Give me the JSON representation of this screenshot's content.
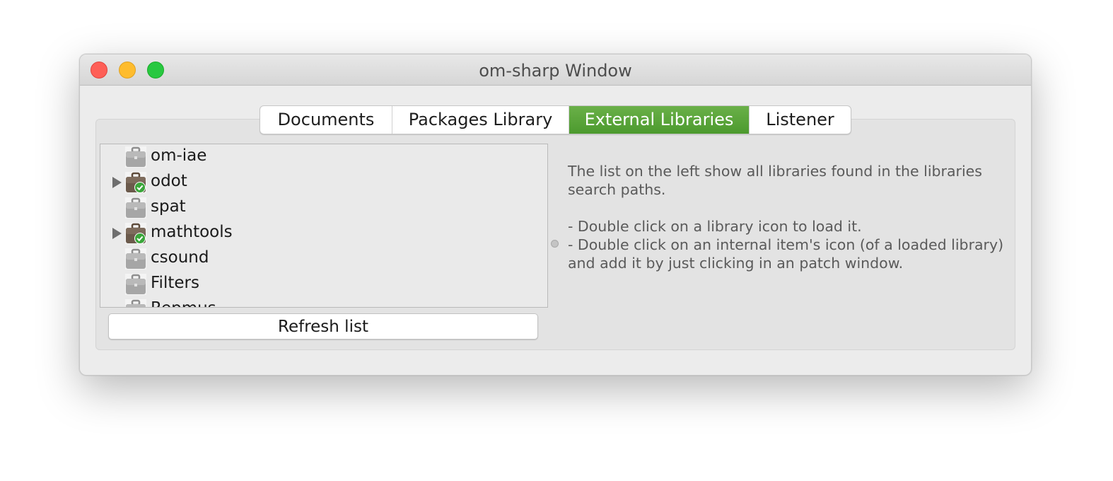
{
  "window": {
    "title": "om-sharp Window"
  },
  "tabs": [
    {
      "label": "Documents",
      "active": false
    },
    {
      "label": "Packages Library",
      "active": false
    },
    {
      "label": "External Libraries",
      "active": true
    },
    {
      "label": "Listener",
      "active": false
    }
  ],
  "colors": {
    "active_tab": "#5aa43b",
    "loaded_badge": "#3aa63a"
  },
  "libraries": [
    {
      "name": "om-iae",
      "loaded": false,
      "expandable": false
    },
    {
      "name": "odot",
      "loaded": true,
      "expandable": true
    },
    {
      "name": "spat",
      "loaded": false,
      "expandable": false
    },
    {
      "name": "mathtools",
      "loaded": true,
      "expandable": true
    },
    {
      "name": "csound",
      "loaded": false,
      "expandable": false
    },
    {
      "name": "Filters",
      "loaded": false,
      "expandable": false
    },
    {
      "name": "Repmus",
      "loaded": false,
      "expandable": false
    }
  ],
  "refresh_button": {
    "label": "Refresh list"
  },
  "help": {
    "intro": "The list on the left show all libraries found in the libraries search paths.",
    "tip1": "- Double click on a library icon to load it.",
    "tip2": "- Double click on an internal item's icon (of a loaded library) and add it by just clicking in an patch window."
  }
}
